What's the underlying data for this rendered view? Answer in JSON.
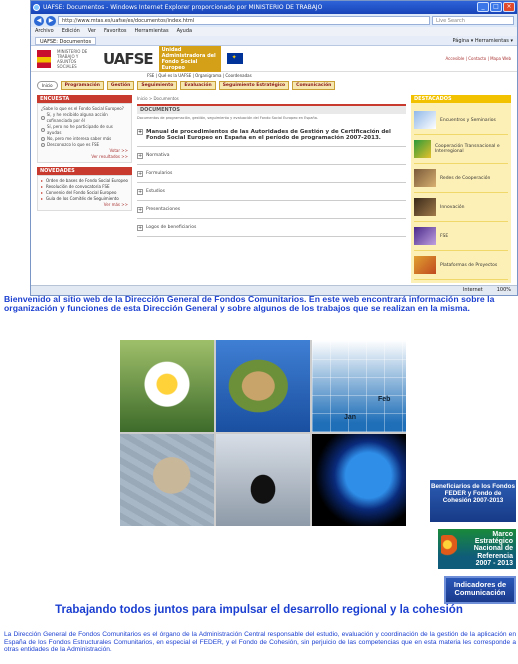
{
  "browser": {
    "window_title": "UAFSE: Documentos - Windows Internet Explorer proporcionado por MINISTERIO DE TRABAJO",
    "url": "http://www.mtas.es/uafse/es/documentos/index.html",
    "search_placeholder": "Live Search",
    "menu": [
      "Archivo",
      "Edición",
      "Ver",
      "Favoritos",
      "Herramientas",
      "Ayuda"
    ],
    "tab_label": "UAFSE: Documentos",
    "toolbar_right": "Página ▾  Herramientas ▾",
    "status_zone": "Internet",
    "status_zoom": "100%"
  },
  "site": {
    "logo": "UAFSE",
    "ministerio": "MINISTERIO DE TRABAJO Y ASUNTOS SOCIALES",
    "unidad": "Unidad Administradora del Fondo Social Europeo",
    "header_links": "Accesible | Contacto | Mapa Web",
    "subnav": "FSE | Qué es la UAFSE | Organigrama | Coordenadas",
    "inicio": "Inicio",
    "tabs": [
      "Programación",
      "Gestión",
      "Seguimiento",
      "Evaluación",
      "Seguimiento Estratégico",
      "Comunicación"
    ],
    "encuesta_title": "ENCUESTA",
    "encuesta_question": "¿Sabe lo que es el Fondo Social Europeo?",
    "encuesta_options": [
      "Sí, y he recibido alguna acción cofinanciada por él",
      "Sí, pero no he participado de sus ayudas",
      "No, pero me interesa saber más",
      "Desconozco lo que es FSE"
    ],
    "votar": "Votar >>",
    "resultados": "Ver resultados >>",
    "novedades_title": "NOVEDADES",
    "novedades": [
      "Orden de bases de Fondo Social Europeo",
      "Resolución de convocatoria FSE",
      "Convenio del Fondo Social Europeo",
      "Guía de los Comités de Seguimiento"
    ],
    "ver_mas": "Ver más >>",
    "crumb": "Inicio > Documentos",
    "documentos_title": "DOCUMENTOS",
    "documentos_intro": "Documentos de programación, gestión, seguimiento y evaluación del Fondo Social Europeo en España.",
    "doc_main": "Manual de procedimientos de las Autoridades de Gestión y de Certificación del Fondo Social Europeo en España en el período de programación 2007-2013.",
    "doc_items": [
      "Normativa",
      "Formularios",
      "Estudios",
      "Presentaciones",
      "Logos de beneficiarios"
    ],
    "destacados_title": "DESTACADOS",
    "destacados": [
      "Encuentros y Seminarios",
      "Cooperación Transnacional e Interregional",
      "Redes de Cooperación",
      "Innovación",
      "FSE",
      "Plataformas de Proyectos"
    ]
  },
  "intro_text": "Bienvenido al sitio web de la Dirección General de Fondos Comunitarios. En este web encontrará información sobre la organización y funciones de esta Dirección General y sobre algunos de los trabajos que se realizan en la misma.",
  "collage": {
    "graph_labels": [
      "Jan",
      "Feb"
    ]
  },
  "badges": {
    "fondos": "Beneficiarios de los Fondos FEDER y Fondo de Cohesión 2007-2013",
    "marco": "Marco Estratégico Nacional de Referencia 2007 - 2013",
    "indicadores": "Indicadores de Comunicación"
  },
  "headline": "Trabajando todos juntos para impulsar el desarrollo regional y la cohesión",
  "body_paragraph": "La Dirección General de Fondos Comunitarios es el órgano de la Administración Central responsable del estudio, evaluación y coordinación de la gestión de la aplicación en España de los Fondos Estructurales Comunitarios, en especial el FEDER, y el Fondo de Cohesión, sin perjuicio de las competencias que en esta materia les corresponde a otras entidades de la Administración.",
  "colors": {
    "brand_blue": "#1b3fd0",
    "site_red": "#c83a2e",
    "site_gold": "#f2c200"
  }
}
